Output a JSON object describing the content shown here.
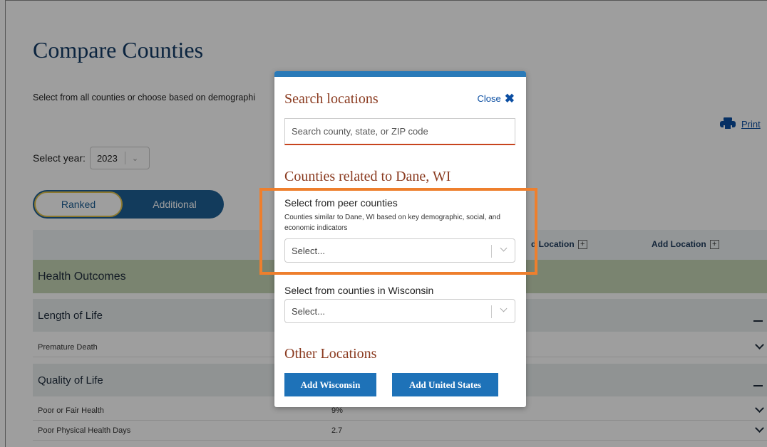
{
  "page": {
    "title": "Compare Counties",
    "subtitle": "Select from all counties or choose based on demographi",
    "print_label": "Print",
    "year_label": "Select year:",
    "year_value": "2023",
    "toggle": {
      "ranked": "Ranked",
      "additional": "Additional"
    },
    "add_location_1": "Add Location",
    "add_location_2": "Add Location",
    "add_location_1_prefix": "d Location",
    "sections": {
      "health_outcomes": "Health Outcomes",
      "length_of_life": "Length of Life",
      "premature_death": "Premature Death",
      "quality_of_life": "Quality of Life",
      "poor_fair_health": "Poor or Fair Health",
      "poor_fair_health_value": "9%",
      "poor_physical_days": "Poor Physical Health Days",
      "poor_physical_days_value": "2.7"
    }
  },
  "modal": {
    "title": "Search locations",
    "close_label": "Close",
    "search_placeholder": "Search county, state, or ZIP code",
    "related_title": "Counties related to Dane, WI",
    "peer_label": "Select from peer counties",
    "peer_description": "Counties similar to Dane, WI based on key demographic, social, and economic indicators",
    "peer_select_placeholder": "Select...",
    "state_label": "Select from counties in Wisconsin",
    "state_select_placeholder": "Select...",
    "other_title": "Other Locations",
    "add_state_button": "Add Wisconsin",
    "add_us_button": "Add United States"
  },
  "colors": {
    "modal_accent": "#2a7ab8",
    "heading_rust": "#8a3a1f",
    "button_blue": "#1e72b8",
    "highlight_orange": "#ee7f2d",
    "health_outcomes_band": "#c6d5b5"
  },
  "icons": {
    "print": "printer-icon",
    "close": "close-x-icon",
    "add": "plus-box-icon",
    "expand": "chevron-down-icon",
    "collapse": "minus-icon"
  }
}
